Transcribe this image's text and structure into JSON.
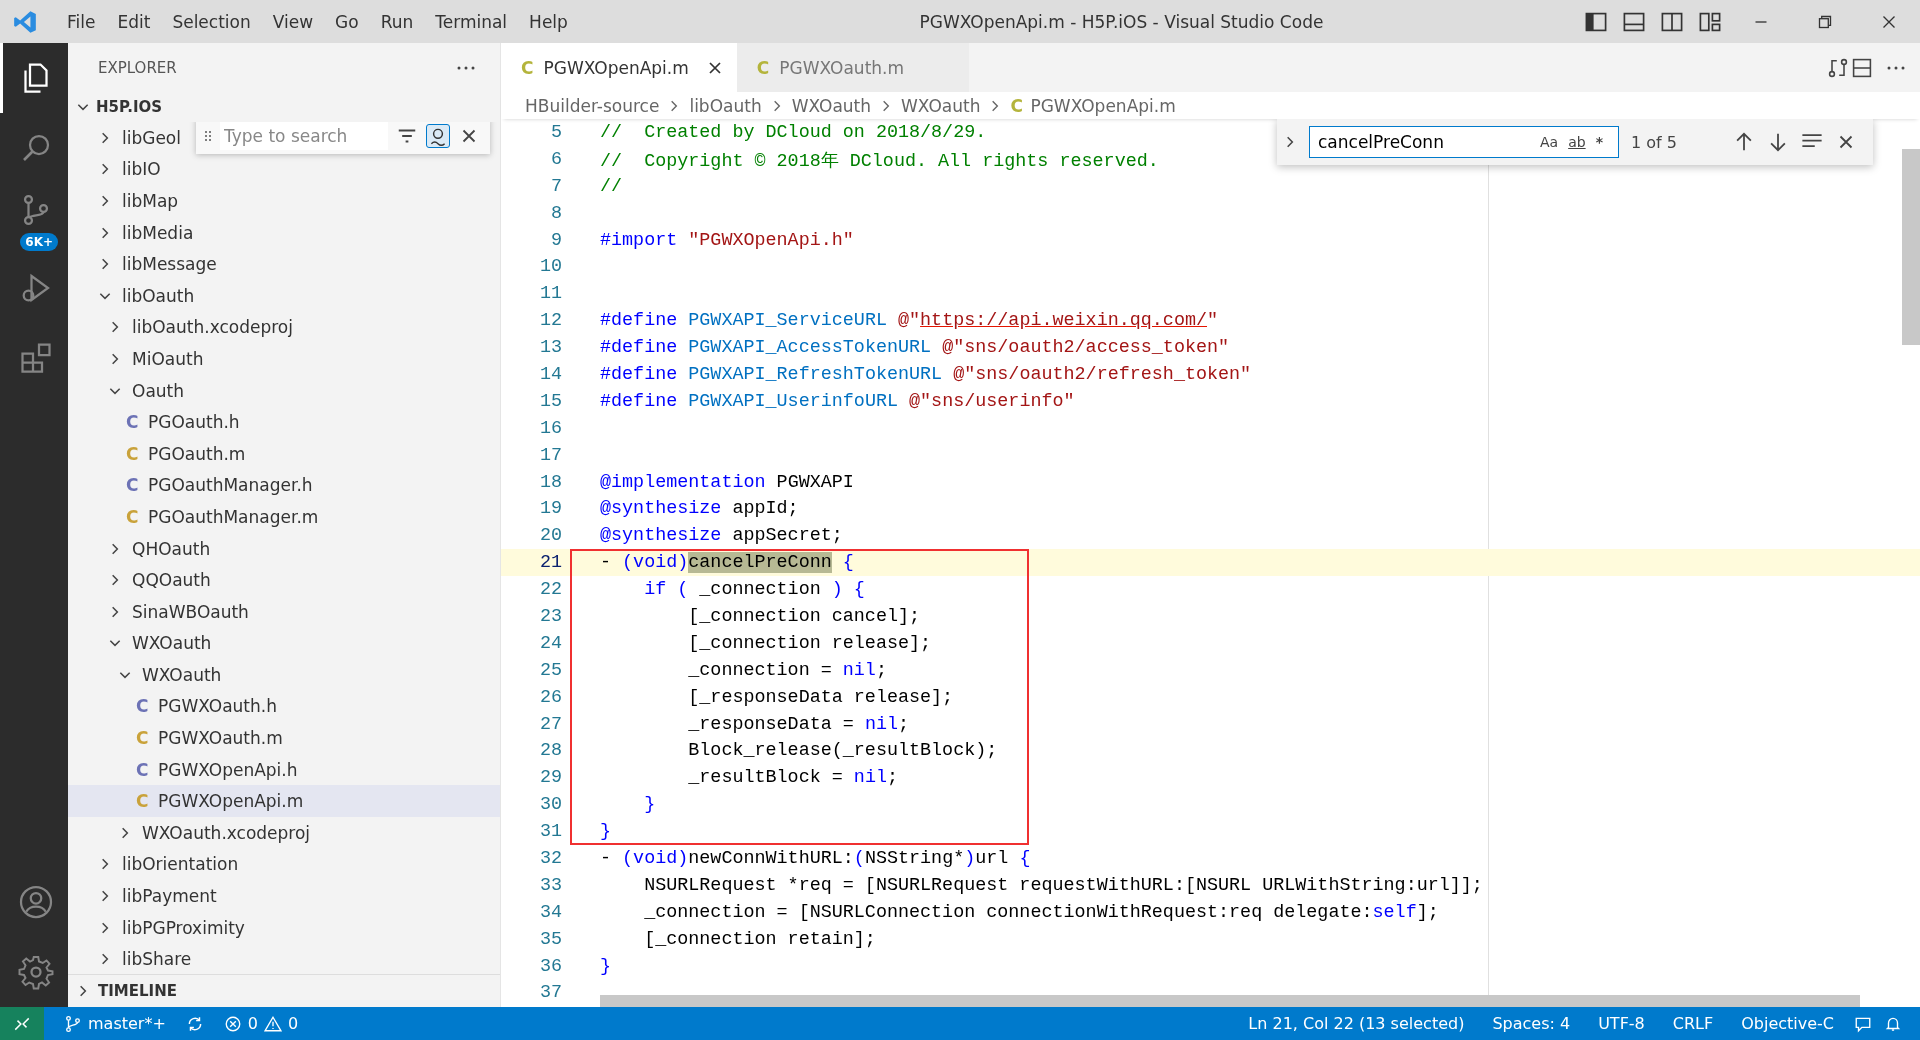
{
  "window": {
    "title": "PGWXOpenApi.m - H5P.iOS - Visual Studio Code"
  },
  "menu": [
    "File",
    "Edit",
    "Selection",
    "View",
    "Go",
    "Run",
    "Terminal",
    "Help"
  ],
  "activity_bar": {
    "items": [
      {
        "kind": "explorer",
        "selected": true
      },
      {
        "kind": "search",
        "selected": false
      },
      {
        "kind": "scm",
        "selected": false,
        "badge": "6K+"
      },
      {
        "kind": "debug",
        "selected": false
      },
      {
        "kind": "extensions",
        "selected": false
      }
    ]
  },
  "sidebar": {
    "title": "EXPLORER",
    "root": "H5P.IOS",
    "search": {
      "placeholder": "Type to search"
    },
    "tree": [
      {
        "label": "libGeol",
        "expanded": false
      },
      {
        "label": "libIO",
        "expanded": false
      },
      {
        "label": "libMap",
        "expanded": false
      },
      {
        "label": "libMedia",
        "expanded": false
      },
      {
        "label": "libMessage",
        "expanded": false
      },
      {
        "label": "libOauth",
        "expanded": true,
        "children": [
          {
            "label": "libOauth.xcodeproj",
            "expanded": false
          },
          {
            "label": "MiOauth",
            "expanded": false
          },
          {
            "label": "Oauth",
            "expanded": true,
            "children": [
              {
                "label": "PGOauth.h",
                "icon": "C",
                "color": "#6c72b5",
                "selected": false
              },
              {
                "label": "PGOauth.m",
                "icon": "C",
                "color": "#c9a23a",
                "selected": false
              },
              {
                "label": "PGOauthManager.h",
                "icon": "C",
                "color": "#6c72b5",
                "selected": false
              },
              {
                "label": "PGOauthManager.m",
                "icon": "C",
                "color": "#c9a23a",
                "selected": false
              }
            ]
          },
          {
            "label": "QHOauth",
            "expanded": false
          },
          {
            "label": "QQOauth",
            "expanded": false
          },
          {
            "label": "SinaWBOauth",
            "expanded": false
          },
          {
            "label": "WXOauth",
            "expanded": true,
            "children": [
              {
                "label": "WXOauth",
                "expanded": true,
                "children": [
                  {
                    "label": "PGWXOauth.h",
                    "icon": "C",
                    "color": "#6c72b5",
                    "selected": false
                  },
                  {
                    "label": "PGWXOauth.m",
                    "icon": "C",
                    "color": "#c9a23a",
                    "selected": false
                  },
                  {
                    "label": "PGWXOpenApi.h",
                    "icon": "C",
                    "color": "#6c72b5",
                    "selected": false
                  },
                  {
                    "label": "PGWXOpenApi.m",
                    "icon": "C",
                    "color": "#c9a23a",
                    "selected": true
                  }
                ]
              },
              {
                "label": "WXOauth.xcodeproj",
                "expanded": false
              }
            ]
          }
        ]
      },
      {
        "label": "libOrientation",
        "expanded": false
      },
      {
        "label": "libPayment",
        "expanded": false
      },
      {
        "label": "libPGProximity",
        "expanded": false
      },
      {
        "label": "libShare",
        "expanded": false
      }
    ],
    "timeline": "TIMELINE"
  },
  "tabs": [
    {
      "label": "PGWXOpenApi.m",
      "icon": "C",
      "selected": true
    },
    {
      "label": "PGWXOauth.m",
      "icon": "C",
      "selected": false
    }
  ],
  "breadcrumbs": {
    "items": [
      "HBuilder-source",
      "libOauth",
      "WXOauth",
      "WXOauth"
    ],
    "file_icon": "C",
    "file": "PGWXOpenApi.m"
  },
  "find": {
    "value": "cancelPreConn",
    "options": [
      "Aa",
      "ab",
      "*"
    ],
    "count": "1 of 5"
  },
  "code": [
    {
      "n": "5",
      "current": false,
      "boxed": false,
      "tokens": [
        {
          "kind": "comment",
          "text": "//  Created by DCloud on 2018/8/29."
        }
      ]
    },
    {
      "n": "6",
      "current": false,
      "boxed": false,
      "tokens": [
        {
          "kind": "comment",
          "text": "//  Copyright © 2018年 DCloud. All rights reserved."
        }
      ]
    },
    {
      "n": "7",
      "current": false,
      "boxed": false,
      "tokens": [
        {
          "kind": "comment",
          "text": "//"
        }
      ]
    },
    {
      "n": "8",
      "current": false,
      "boxed": false
    },
    {
      "n": "9",
      "current": false,
      "boxed": false,
      "tokens": [
        {
          "kind": "keyword",
          "text": "#import "
        },
        {
          "kind": "string",
          "text": "\"PGWXOpenApi.h\""
        }
      ]
    },
    {
      "n": "10",
      "current": false,
      "boxed": false
    },
    {
      "n": "11",
      "current": false,
      "boxed": false
    },
    {
      "n": "12",
      "current": false,
      "boxed": false,
      "tokens": [
        {
          "kind": "keyword",
          "text": "#define "
        },
        {
          "kind": "name",
          "text": "PGWXAPI_ServiceURL "
        },
        {
          "kind": "string",
          "text": "@\""
        },
        {
          "kind": "link",
          "text": "https://api.weixin.qq.com/"
        },
        {
          "kind": "string",
          "text": "\""
        }
      ]
    },
    {
      "n": "13",
      "current": false,
      "boxed": false,
      "tokens": [
        {
          "kind": "keyword",
          "text": "#define "
        },
        {
          "kind": "name",
          "text": "PGWXAPI_AccessTokenURL "
        },
        {
          "kind": "string",
          "text": "@\"sns/oauth2/access_token\""
        }
      ]
    },
    {
      "n": "14",
      "current": false,
      "boxed": false,
      "tokens": [
        {
          "kind": "keyword",
          "text": "#define "
        },
        {
          "kind": "name",
          "text": "PGWXAPI_RefreshTokenURL "
        },
        {
          "kind": "string",
          "text": "@\"sns/oauth2/refresh_token\""
        }
      ]
    },
    {
      "n": "15",
      "current": false,
      "boxed": false,
      "tokens": [
        {
          "kind": "keyword",
          "text": "#define "
        },
        {
          "kind": "name",
          "text": "PGWXAPI_UserinfoURL "
        },
        {
          "kind": "string",
          "text": "@\"sns/userinfo\""
        }
      ]
    },
    {
      "n": "16",
      "current": false,
      "boxed": false
    },
    {
      "n": "17",
      "current": false,
      "boxed": false
    },
    {
      "n": "18",
      "current": false,
      "boxed": false,
      "tokens": [
        {
          "kind": "keyword",
          "text": "@implementation "
        },
        {
          "kind": "plain",
          "text": "PGWXAPI"
        }
      ]
    },
    {
      "n": "19",
      "current": false,
      "boxed": false,
      "tokens": [
        {
          "kind": "keyword",
          "text": "@synthesize "
        },
        {
          "kind": "plain",
          "text": "appId;"
        }
      ]
    },
    {
      "n": "20",
      "current": false,
      "boxed": false,
      "tokens": [
        {
          "kind": "keyword",
          "text": "@synthesize "
        },
        {
          "kind": "plain",
          "text": "appSecret;"
        }
      ]
    },
    {
      "n": "21",
      "current": true,
      "boxed": true,
      "tokens": [
        {
          "kind": "plain",
          "text": "- "
        },
        {
          "kind": "keyword",
          "text": "(void)"
        },
        {
          "kind": "match",
          "text": "cancelPreConn"
        },
        {
          "kind": "keyword",
          "text": " {"
        }
      ]
    },
    {
      "n": "22",
      "current": false,
      "boxed": true,
      "tokens": [
        {
          "kind": "keyword",
          "text": "    if ( "
        },
        {
          "kind": "plain",
          "text": "_connection"
        },
        {
          "kind": "keyword",
          "text": " ) {"
        }
      ]
    },
    {
      "n": "23",
      "current": false,
      "boxed": true,
      "tokens": [
        {
          "kind": "plain",
          "text": "        [_connection cancel];"
        }
      ]
    },
    {
      "n": "24",
      "current": false,
      "boxed": true,
      "tokens": [
        {
          "kind": "plain",
          "text": "        [_connection release];"
        }
      ]
    },
    {
      "n": "25",
      "current": false,
      "boxed": true,
      "tokens": [
        {
          "kind": "plain",
          "text": "        _connection = "
        },
        {
          "kind": "keyword",
          "text": "nil"
        },
        {
          "kind": "plain",
          "text": ";"
        }
      ]
    },
    {
      "n": "26",
      "current": false,
      "boxed": true,
      "tokens": [
        {
          "kind": "plain",
          "text": "        [_responseData release];"
        }
      ]
    },
    {
      "n": "27",
      "current": false,
      "boxed": true,
      "tokens": [
        {
          "kind": "plain",
          "text": "        _responseData = "
        },
        {
          "kind": "keyword",
          "text": "nil"
        },
        {
          "kind": "plain",
          "text": ";"
        }
      ]
    },
    {
      "n": "28",
      "current": false,
      "boxed": true,
      "tokens": [
        {
          "kind": "plain",
          "text": "        Block_release(_resultBlock);"
        }
      ]
    },
    {
      "n": "29",
      "current": false,
      "boxed": true,
      "tokens": [
        {
          "kind": "plain",
          "text": "        _resultBlock = "
        },
        {
          "kind": "keyword",
          "text": "nil"
        },
        {
          "kind": "plain",
          "text": ";"
        }
      ]
    },
    {
      "n": "30",
      "current": false,
      "boxed": true,
      "tokens": [
        {
          "kind": "keyword",
          "text": "    }"
        }
      ]
    },
    {
      "n": "31",
      "current": false,
      "boxed": true,
      "tokens": [
        {
          "kind": "keyword",
          "text": "}"
        }
      ]
    },
    {
      "n": "32",
      "current": false,
      "boxed": false,
      "tokens": [
        {
          "kind": "plain",
          "text": "- "
        },
        {
          "kind": "keyword",
          "text": "(void)"
        },
        {
          "kind": "plain",
          "text": "newConnWithURL:"
        },
        {
          "kind": "keyword",
          "text": "("
        },
        {
          "kind": "plain",
          "text": "NSString*"
        },
        {
          "kind": "keyword",
          "text": ")"
        },
        {
          "kind": "plain",
          "text": "url "
        },
        {
          "kind": "keyword",
          "text": "{"
        }
      ]
    },
    {
      "n": "33",
      "current": false,
      "boxed": false,
      "tokens": [
        {
          "kind": "plain",
          "text": "    NSURLRequest *req = [NSURLRequest requestWithURL:[NSURL URLWithString:url]];"
        }
      ]
    },
    {
      "n": "34",
      "current": false,
      "boxed": false,
      "tokens": [
        {
          "kind": "plain",
          "text": "    _connection = [NSURLConnection connectionWithRequest:req delegate:"
        },
        {
          "kind": "keyword",
          "text": "self"
        },
        {
          "kind": "plain",
          "text": "];"
        }
      ]
    },
    {
      "n": "35",
      "current": false,
      "boxed": false,
      "tokens": [
        {
          "kind": "plain",
          "text": "    [_connection retain];"
        }
      ]
    },
    {
      "n": "36",
      "current": false,
      "boxed": false,
      "tokens": [
        {
          "kind": "keyword",
          "text": "}"
        }
      ]
    },
    {
      "n": "37",
      "current": false,
      "boxed": false
    }
  ],
  "status_bar": {
    "branch": "master*+",
    "errors": "0",
    "warnings": "0",
    "items": [
      "Ln 21, Col 22 (13 selected)",
      "Spaces: 4",
      "UTF-8",
      "CRLF",
      "Objective-C"
    ]
  }
}
